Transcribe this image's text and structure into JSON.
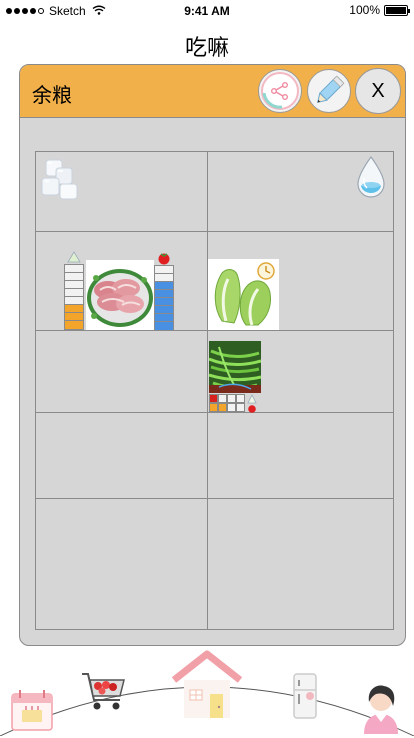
{
  "status_bar": {
    "carrier": "Sketch",
    "time": "9:41 AM",
    "battery": "100%"
  },
  "page": {
    "title": "吃嘛"
  },
  "card": {
    "title": "余粮",
    "close_label": "X"
  },
  "items": {
    "meat_meter_left_level": 0.375,
    "meat_meter_right_level": 0.75,
    "beans_level_filled": 3,
    "beans_level_total": 5
  },
  "colors": {
    "header": "#f2b04a",
    "panel": "#d6d6d6",
    "meter_orange": "#f2a52a",
    "meter_blue": "#4a90e2",
    "house": "#f2a0a8"
  },
  "icons": [
    "ice-icon",
    "water-drop-icon",
    "meat-icon",
    "cabbage-icon",
    "clock-icon",
    "green-beans-icon",
    "tomato-icon",
    "share-icon",
    "edit-icon",
    "calendar-icon",
    "cart-icon",
    "home-icon",
    "fridge-icon",
    "user-icon"
  ]
}
